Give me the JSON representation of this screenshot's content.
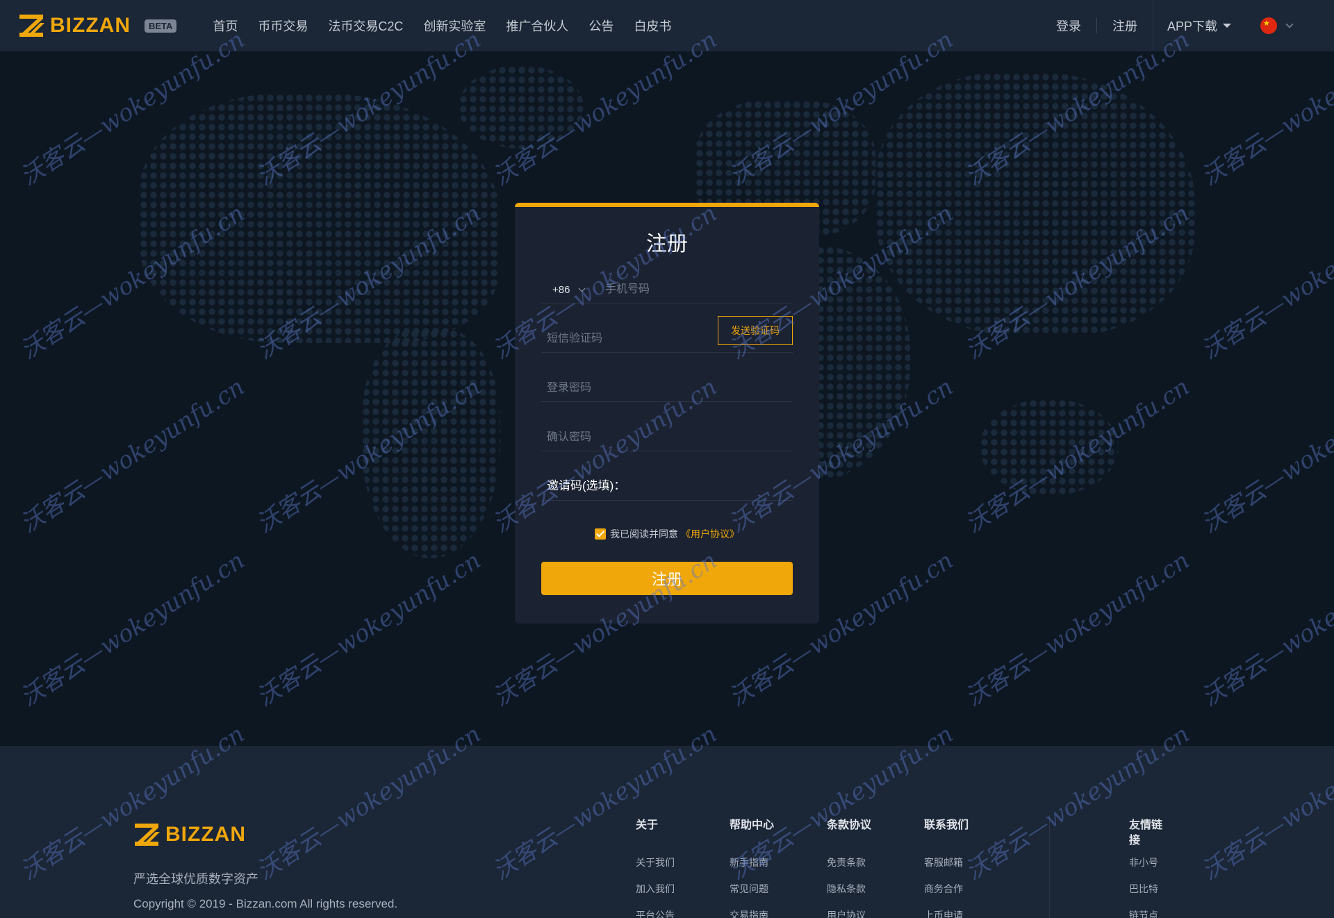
{
  "header": {
    "brand": "BIZZAN",
    "beta_badge": "BETA",
    "nav": [
      "首页",
      "币币交易",
      "法币交易C2C",
      "创新实验室",
      "推广合伙人",
      "公告",
      "白皮书"
    ],
    "login": "登录",
    "register": "注册",
    "app_download": "APP下载",
    "language_icon": "china-flag-icon"
  },
  "form": {
    "title": "注册",
    "country_code": "+86",
    "phone_placeholder": "手机号码",
    "sms_placeholder": "短信验证码",
    "send_code": "发送验证码",
    "password_placeholder": "登录密码",
    "confirm_placeholder": "确认密码",
    "invite_label": "邀请码(选填)：",
    "agree_text": "我已阅读并同意",
    "agree_link": "《用户协议》",
    "agree_checked": true,
    "submit": "注册"
  },
  "footer": {
    "brand": "BIZZAN",
    "slogan": "严选全球优质数字资产",
    "copyright": "Copyright © 2019 - Bizzan.com All rights reserved.",
    "columns": [
      {
        "title": "关于",
        "items": [
          "关于我们",
          "加入我们",
          "平台公告"
        ]
      },
      {
        "title": "帮助中心",
        "items": [
          "新手指南",
          "常见问题",
          "交易指南"
        ]
      },
      {
        "title": "条款协议",
        "items": [
          "免责条款",
          "隐私条款",
          "用户协议"
        ]
      },
      {
        "title": "联系我们",
        "items": [
          "客服邮箱",
          "商务合作",
          "上币申请"
        ]
      },
      {
        "title": "友情链接",
        "items": [
          "非小号",
          "巴比特",
          "链节点"
        ]
      }
    ]
  },
  "watermark": "沃客云—wokeyunfu.cn",
  "colors": {
    "accent": "#f0a70a",
    "header_bg": "#1b2636",
    "card_bg": "#1b2231",
    "page_bg": "#0d1722"
  }
}
